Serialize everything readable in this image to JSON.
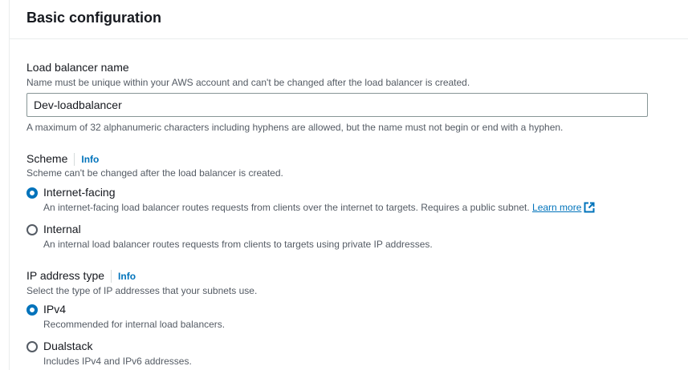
{
  "section": {
    "title": "Basic configuration"
  },
  "lb_name": {
    "label": "Load balancer name",
    "description": "Name must be unique within your AWS account and can't be changed after the load balancer is created.",
    "value": "Dev-loadbalancer",
    "constraint": "A maximum of 32 alphanumeric characters including hyphens are allowed, but the name must not begin or end with a hyphen."
  },
  "scheme": {
    "label": "Scheme",
    "info": "Info",
    "description": "Scheme can't be changed after the load balancer is created.",
    "options": [
      {
        "label": "Internet-facing",
        "description": "An internet-facing load balancer routes requests from clients over the internet to targets. Requires a public subnet.",
        "link": "Learn more",
        "selected": true
      },
      {
        "label": "Internal",
        "description": "An internal load balancer routes requests from clients to targets using private IP addresses.",
        "selected": false
      }
    ]
  },
  "ip_type": {
    "label": "IP address type",
    "info": "Info",
    "description": "Select the type of IP addresses that your subnets use.",
    "options": [
      {
        "label": "IPv4",
        "description": "Recommended for internal load balancers.",
        "selected": true
      },
      {
        "label": "Dualstack",
        "description": "Includes IPv4 and IPv6 addresses.",
        "selected": false
      }
    ]
  },
  "colors": {
    "accent": "#0073bb",
    "text": "#16191f",
    "muted": "#545b64"
  }
}
